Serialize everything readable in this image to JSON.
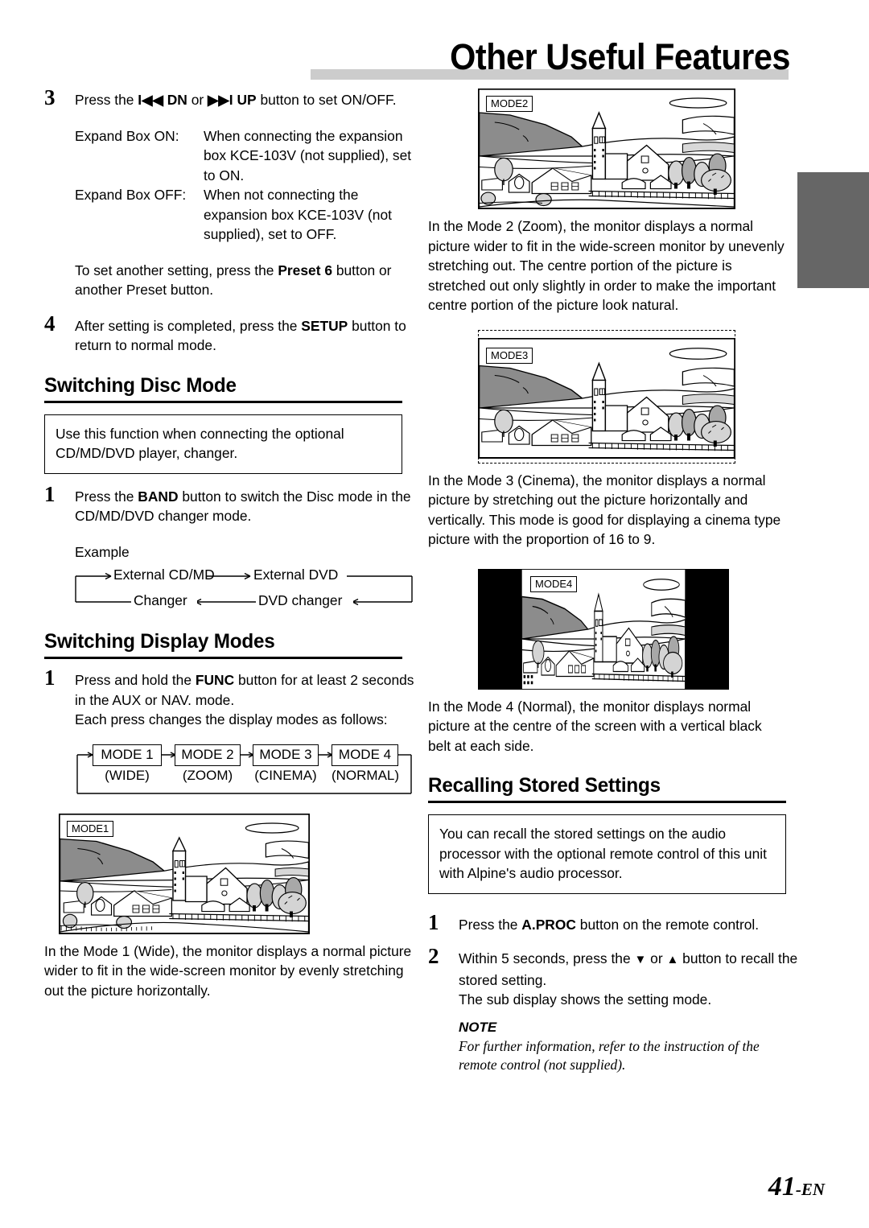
{
  "page": {
    "title": "Other Useful Features",
    "number": "41",
    "number_suffix": "-EN"
  },
  "left_column": {
    "step3": {
      "num": "3",
      "text_before": "Press the ",
      "icon_dn": "I◀◀",
      "label_dn": "DN",
      "text_mid": " or ",
      "icon_up": "▶▶I",
      "label_up": "UP",
      "text_after": " button to set ON/OFF.",
      "definitions": [
        {
          "label": "Expand Box ON:",
          "desc": "When connecting the expansion box KCE-103V (not supplied), set to ON."
        },
        {
          "label": "Expand Box OFF:",
          "desc": "When not connecting the expansion box KCE-103V (not supplied), set to OFF."
        }
      ],
      "note_before": "To set another setting, press the ",
      "note_bold": "Preset 6",
      "note_after": " button or another Preset button."
    },
    "step4": {
      "num": "4",
      "text_before": "After setting is completed, press the ",
      "bold": "SETUP",
      "text_after": " button to return to normal mode."
    },
    "section_disc_mode": {
      "heading": "Switching Disc Mode",
      "callout": "Use this function when connecting the optional CD/MD/DVD player, changer.",
      "step1": {
        "num": "1",
        "text_before": "Press the ",
        "bold": "BAND",
        "text_after": " button to switch the Disc mode in the CD/MD/DVD changer mode."
      },
      "example_label": "Example",
      "flow_nodes": [
        "External CD/MD",
        "External DVD",
        "DVD changer",
        "Changer"
      ]
    },
    "section_display_modes": {
      "heading": "Switching Display Modes",
      "step1": {
        "num": "1",
        "text_before": "Press and hold the ",
        "bold": "FUNC",
        "text_after": " button for at least 2 seconds in the AUX or NAV. mode.",
        "extra": "Each press changes the display modes as follows:"
      },
      "mode_flow": [
        {
          "box": "MODE 1",
          "caption": "(WIDE)"
        },
        {
          "box": "MODE 2",
          "caption": "(ZOOM)"
        },
        {
          "box": "MODE 3",
          "caption": "(CINEMA)"
        },
        {
          "box": "MODE 4",
          "caption": "(NORMAL)"
        }
      ]
    },
    "figure_mode1": {
      "tag": "MODE1",
      "caption": "In the Mode 1 (Wide), the monitor displays a normal picture wider to fit in the wide-screen monitor by evenly stretching out the picture horizontally."
    }
  },
  "right_column": {
    "figure_mode2": {
      "tag": "MODE2",
      "caption": "In the Mode 2 (Zoom), the monitor displays a normal picture wider to fit in the wide-screen monitor by unevenly stretching out. The centre portion of the picture is stretched out only slightly in order to make the important centre portion of the picture look natural."
    },
    "figure_mode3": {
      "tag": "MODE3",
      "caption": "In the Mode 3 (Cinema), the monitor displays a normal picture by stretching out the picture horizontally and vertically. This mode is good for displaying a cinema type picture with the proportion of 16 to 9."
    },
    "figure_mode4": {
      "tag": "MODE4",
      "caption": "In the Mode 4 (Normal), the monitor displays normal picture at the centre of the screen with a vertical black belt at each side."
    },
    "section_recalling": {
      "heading": "Recalling Stored Settings",
      "callout": "You can recall the stored settings on the audio processor with the optional remote control of this unit with Alpine's audio processor.",
      "step1": {
        "num": "1",
        "text_before": "Press the ",
        "bold": "A.PROC",
        "text_after": " button on the remote control."
      },
      "step2": {
        "num": "2",
        "text_before": "Within 5 seconds, press the ",
        "icon_down": "▼",
        "text_mid": " or ",
        "icon_up": "▲",
        "text_after": " button to recall the stored setting.",
        "extra": "The sub display shows the setting mode."
      },
      "note_title": "NOTE",
      "note_body": "For further information, refer to the instruction of the remote control (not supplied)."
    }
  },
  "colors": {
    "header_bar": "#cccccc",
    "side_tab": "#666666",
    "mountain_dark": "#8c8c8c",
    "mountain_light": "#d8d8d8",
    "tree_light": "#d4d4d4",
    "tree_dark": "#a8a8a8",
    "belt_black": "#000000"
  }
}
